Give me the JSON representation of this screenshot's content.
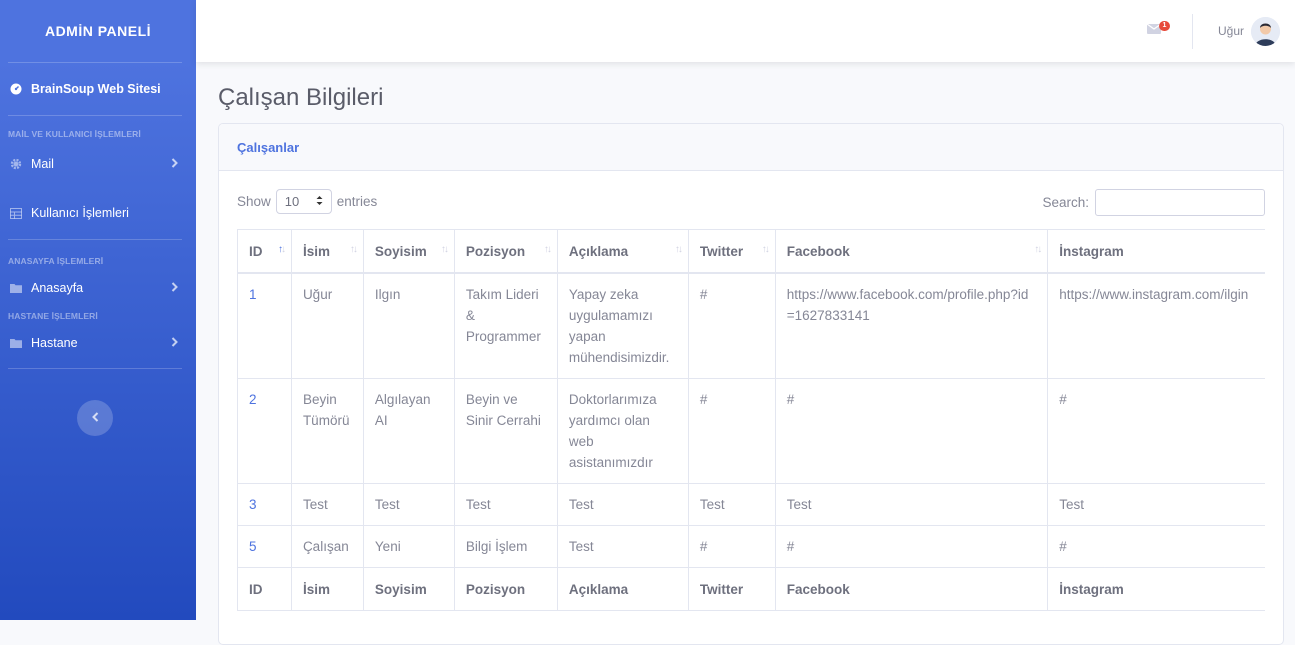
{
  "sidebar": {
    "brand": "ADMİN PANELİ",
    "website": "BrainSoup Web Sitesi",
    "heading_mail": "MAİL VE KULLANICI İŞLEMLERİ",
    "mail": "Mail",
    "users": "Kullanıcı İşlemleri",
    "heading_home": "ANASAYFA İŞLEMLERİ",
    "home": "Anasayfa",
    "heading_hospital": "HASTANE İŞLEMLERİ",
    "hospital": "Hastane"
  },
  "topbar": {
    "mail_badge": "1",
    "user_name": "Uğur"
  },
  "page": {
    "title": "Çalışan Bilgileri",
    "card_title": "Çalışanlar"
  },
  "controls": {
    "show_label": "Show",
    "entries_value": "10",
    "entries_label": "entries",
    "search_label": "Search:"
  },
  "table": {
    "headers": [
      "ID",
      "İsim",
      "Soyisim",
      "Pozisyon",
      "Açıklama",
      "Twitter",
      "Facebook",
      "İnstagram"
    ],
    "rows": [
      [
        "1",
        "Uğur",
        "Ilgın",
        "Takım Lideri & Programmer",
        "Yapay zeka uygulamamızı yapan mühendisimizdir.",
        "#",
        "https://www.facebook.com/profile.php?id=1627833141",
        "https://www.instagram.com/ilgin"
      ],
      [
        "2",
        "Beyin Tümörü",
        "Algılayan AI",
        "Beyin ve Sinir Cerrahi",
        "Doktorlarımıza yardımcı olan web asistanımızdır",
        "#",
        "#",
        "#"
      ],
      [
        "3",
        "Test",
        "Test",
        "Test",
        "Test",
        "Test",
        "Test",
        "Test"
      ],
      [
        "5",
        "Çalışan",
        "Yeni",
        "Bilgi İşlem",
        "Test",
        "#",
        "#",
        "#"
      ]
    ]
  }
}
